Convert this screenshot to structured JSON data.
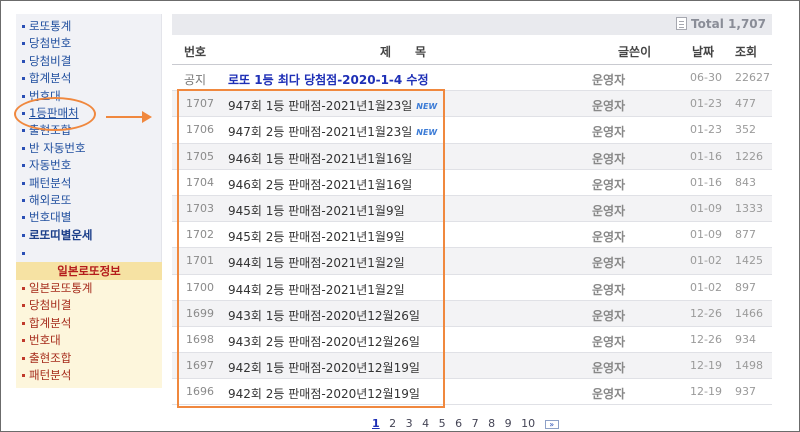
{
  "sidebar": {
    "items": [
      {
        "label": "로또통계"
      },
      {
        "label": "당첨번호"
      },
      {
        "label": "당첨비결"
      },
      {
        "label": "합계분석"
      },
      {
        "label": "번호대"
      },
      {
        "label": "1등판매처"
      },
      {
        "label": "출현조합"
      },
      {
        "label": "반 자동번호"
      },
      {
        "label": "자동번호"
      },
      {
        "label": "패턴분석"
      },
      {
        "label": "해외로또"
      },
      {
        "label": "번호대별"
      },
      {
        "label": "로또띠별운세"
      }
    ],
    "active_index": 5,
    "japan_section": {
      "title": "일본로또정보",
      "items": [
        {
          "label": "일본로또통계"
        },
        {
          "label": "당첨비결"
        },
        {
          "label": "합계분석"
        },
        {
          "label": "번호대"
        },
        {
          "label": "출현조합"
        },
        {
          "label": "패턴분석"
        }
      ]
    }
  },
  "board": {
    "total_label": "Total",
    "total_count": "1,707",
    "columns": {
      "num": "번호",
      "title": "제　　목",
      "author": "글쓴이",
      "date": "날짜",
      "views": "조회"
    },
    "notice": {
      "num": "공지",
      "title": "로또 1등 최다 당첨점-2020-1-4 수정",
      "author": "운영자",
      "date": "06-30",
      "views": "22627"
    },
    "rows": [
      {
        "num": "1707",
        "title": "947회 1등 판매점-2021년1월23일",
        "new": "NEW",
        "author": "운영자",
        "date": "01-23",
        "views": "477"
      },
      {
        "num": "1706",
        "title": "947회 2등 판매점-2021년1월23일",
        "new": "NEW",
        "author": "운영자",
        "date": "01-23",
        "views": "352"
      },
      {
        "num": "1705",
        "title": "946회 1등 판매점-2021년1월16일",
        "new": "",
        "author": "운영자",
        "date": "01-16",
        "views": "1226"
      },
      {
        "num": "1704",
        "title": "946회 2등 판매점-2021년1월16일",
        "new": "",
        "author": "운영자",
        "date": "01-16",
        "views": "843"
      },
      {
        "num": "1703",
        "title": "945회 1등 판매점-2021년1월9일",
        "new": "",
        "author": "운영자",
        "date": "01-09",
        "views": "1333"
      },
      {
        "num": "1702",
        "title": "945회 2등 판매점-2021년1월9일",
        "new": "",
        "author": "운영자",
        "date": "01-09",
        "views": "877"
      },
      {
        "num": "1701",
        "title": "944회 1등 판매점-2021년1월2일",
        "new": "",
        "author": "운영자",
        "date": "01-02",
        "views": "1425"
      },
      {
        "num": "1700",
        "title": "944회 2등 판매점-2021년1월2일",
        "new": "",
        "author": "운영자",
        "date": "01-02",
        "views": "897"
      },
      {
        "num": "1699",
        "title": "943회 1등 판매점-2020년12월26일",
        "new": "",
        "author": "운영자",
        "date": "12-26",
        "views": "1466"
      },
      {
        "num": "1698",
        "title": "943회 2등 판매점-2020년12월26일",
        "new": "",
        "author": "운영자",
        "date": "12-26",
        "views": "934"
      },
      {
        "num": "1697",
        "title": "942회 1등 판매점-2020년12월19일",
        "new": "",
        "author": "운영자",
        "date": "12-19",
        "views": "1498"
      },
      {
        "num": "1696",
        "title": "942회 2등 판매점-2020년12월19일",
        "new": "",
        "author": "운영자",
        "date": "12-19",
        "views": "937"
      }
    ]
  },
  "pagination": {
    "pages": [
      "1",
      "2",
      "3",
      "4",
      "5",
      "6",
      "7",
      "8",
      "9",
      "10"
    ],
    "current": "1",
    "next_label": "»"
  },
  "colors": {
    "highlight": "#f0883e",
    "notice_title": "#1e2fb6",
    "nav_link": "#1f4e9e",
    "japan_link": "#a52a1a"
  },
  "icons": {
    "total": "document-icon",
    "nav_bullet": "square-bullet-icon",
    "arrow": "right-arrow-icon",
    "next": "double-chevron-right-icon"
  }
}
